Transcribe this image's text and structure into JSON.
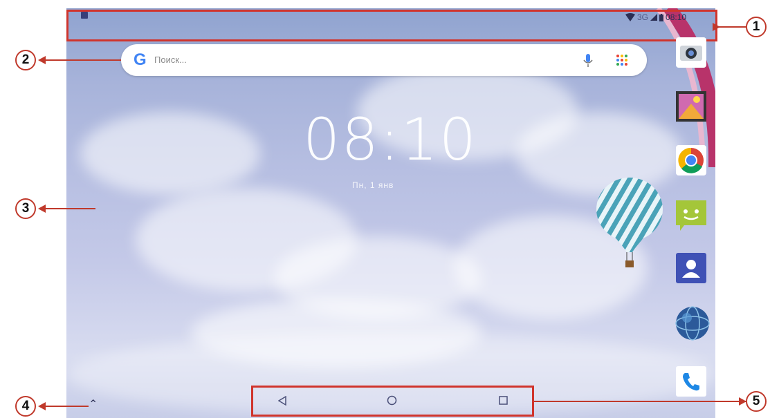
{
  "status_bar": {
    "network": "3G",
    "time": "08:10"
  },
  "search": {
    "placeholder": "Поиск..."
  },
  "home": {
    "clock": "08:10",
    "date": "Пн, 1 янв"
  },
  "dock": {
    "apps": [
      {
        "name": "camera"
      },
      {
        "name": "gallery"
      },
      {
        "name": "chrome"
      },
      {
        "name": "messaging"
      },
      {
        "name": "contacts"
      },
      {
        "name": "browser-globe"
      },
      {
        "name": "phone"
      }
    ]
  },
  "callouts": [
    "1",
    "2",
    "3",
    "4",
    "5"
  ],
  "colors": {
    "callout_red": "#d0342c",
    "google_blue": "#4285f4"
  }
}
